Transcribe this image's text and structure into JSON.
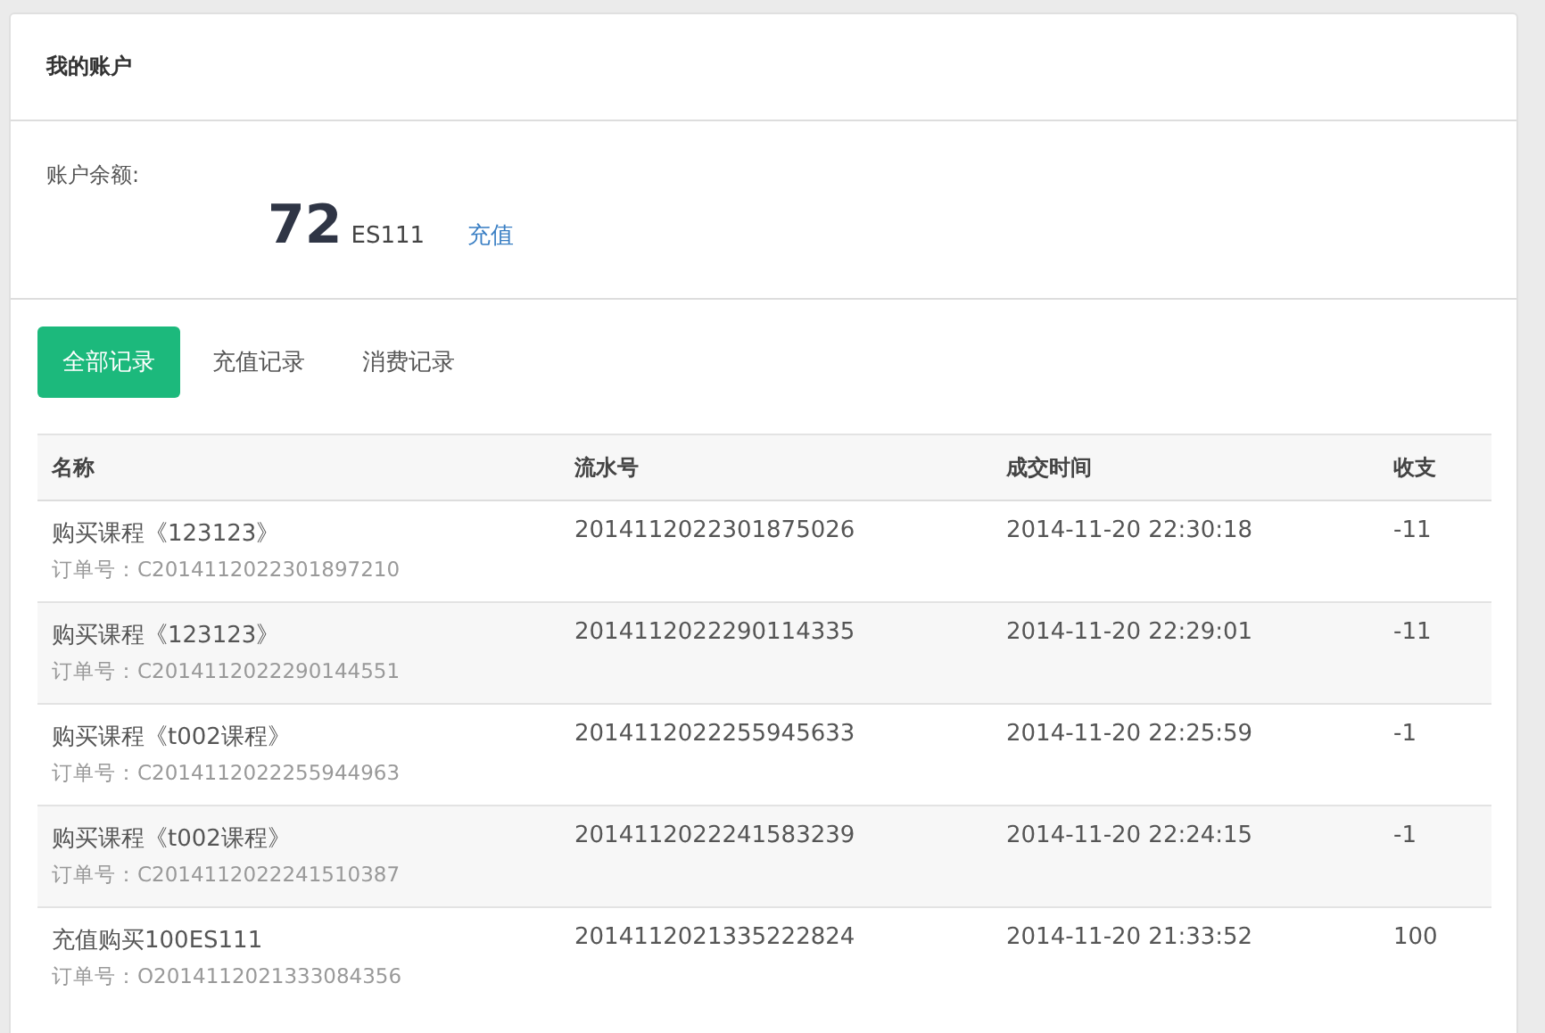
{
  "panel": {
    "title": "我的账户"
  },
  "balance": {
    "label": "账户余额:",
    "amount": "72",
    "unit": "ES111",
    "recharge_link": "充值"
  },
  "tabs": [
    {
      "label": "全部记录",
      "selected": true
    },
    {
      "label": "充值记录",
      "selected": false
    },
    {
      "label": "消费记录",
      "selected": false
    }
  ],
  "table": {
    "columns": [
      "名称",
      "流水号",
      "成交时间",
      "收支"
    ],
    "rows": [
      {
        "name": "购买课程《123123》",
        "order": "订单号：C2014112022301897210",
        "serial": "2014112022301875026",
        "time": "2014-11-20 22:30:18",
        "amount": "-11"
      },
      {
        "name": "购买课程《123123》",
        "order": "订单号：C2014112022290144551",
        "serial": "2014112022290114335",
        "time": "2014-11-20 22:29:01",
        "amount": "-11"
      },
      {
        "name": "购买课程《t002课程》",
        "order": "订单号：C2014112022255944963",
        "serial": "2014112022255945633",
        "time": "2014-11-20 22:25:59",
        "amount": "-1"
      },
      {
        "name": "购买课程《t002课程》",
        "order": "订单号：C2014112022241510387",
        "serial": "2014112022241583239",
        "time": "2014-11-20 22:24:15",
        "amount": "-1"
      },
      {
        "name": "充值购买100ES111",
        "order": "订单号：O2014112021333084356",
        "serial": "2014112021335222824",
        "time": "2014-11-20 21:33:52",
        "amount": "100"
      }
    ]
  }
}
